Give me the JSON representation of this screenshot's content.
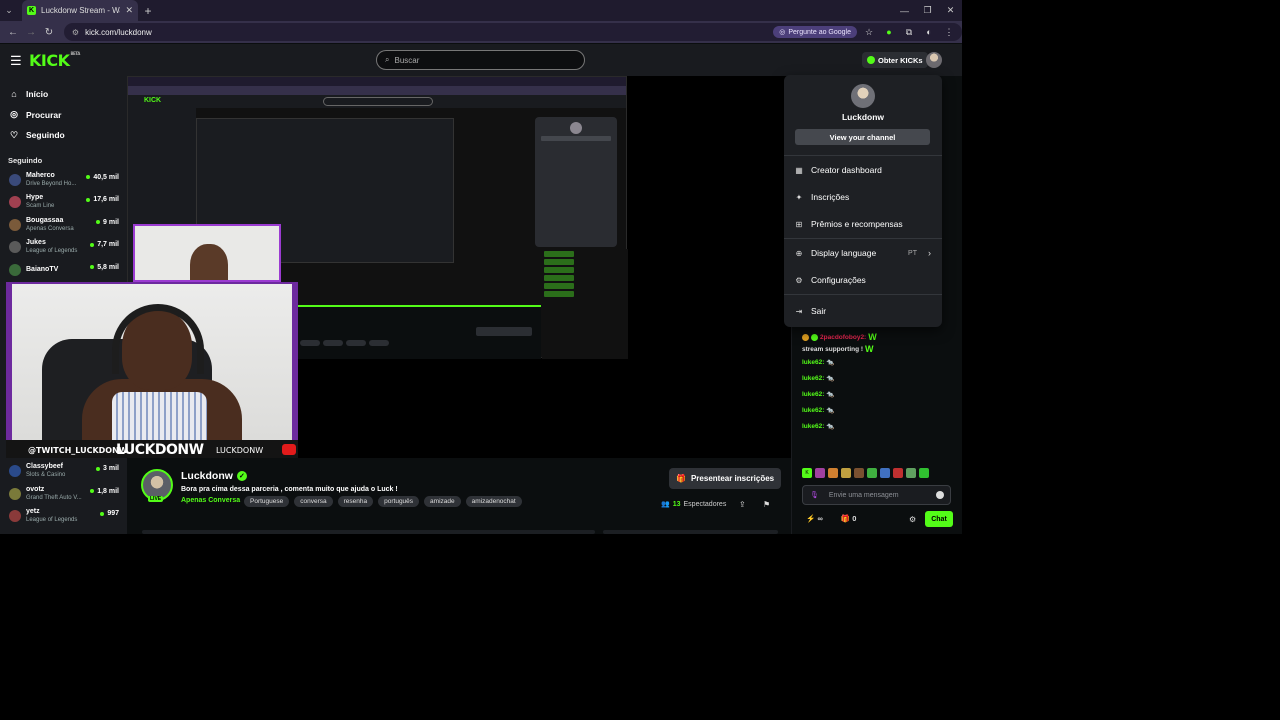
{
  "browser": {
    "tab_title": "Luckdonw Stream - Watch Live",
    "url": "kick.com/luckdonw",
    "ask_google": "Pergunte ao Google"
  },
  "header": {
    "logo": "KICK",
    "logo_badge": "BETA",
    "search_placeholder": "Buscar",
    "get_kicks": "Obter KICKs"
  },
  "sidebar": {
    "nav": [
      {
        "label": "Início",
        "icon": "home-icon"
      },
      {
        "label": "Procurar",
        "icon": "compass-icon"
      },
      {
        "label": "Seguindo",
        "icon": "heart-icon"
      }
    ],
    "following_title": "Seguindo",
    "channels": [
      {
        "name": "Maherco",
        "category": "Drive Beyond Ho...",
        "viewers": "40,5 mil",
        "color": "#3a4a7a"
      },
      {
        "name": "Hype",
        "category": "Scam Line",
        "viewers": "17,6 mil",
        "color": "#a04050"
      },
      {
        "name": "Bougassaa",
        "category": "Apenas Conversa",
        "viewers": "9 mil",
        "color": "#7a5a3a"
      },
      {
        "name": "Jukes",
        "category": "League of Legends",
        "viewers": "7,7 mil",
        "color": "#5a5a5a"
      },
      {
        "name": "BaianoTV",
        "category": "",
        "viewers": "5,8 mil",
        "color": "#3a6a3a"
      }
    ],
    "channels_bottom": [
      {
        "name": "Classybeef",
        "category": "Slots & Casino",
        "viewers": "3 mil",
        "color": "#2a4a8a"
      },
      {
        "name": "ovotz",
        "category": "Grand Theft Auto V...",
        "viewers": "1,8 mil",
        "color": "#7a7a3a"
      },
      {
        "name": "yetz",
        "category": "League of Legends",
        "viewers": "997",
        "color": "#8a3a3a"
      }
    ]
  },
  "overlay": {
    "handle": "@TWITCH_LUCKDONW",
    "big_name": "LUCKDONW",
    "small_name": "LUCKDONW"
  },
  "stream": {
    "name": "Luckdonw",
    "live_label": "LIVE",
    "title": "Bora pra cima dessa parceria , comenta muito que ajuda o Luck !",
    "category": "Apenas Conversa",
    "tags": [
      "Portuguese",
      "conversa",
      "resenha",
      "português",
      "amizade",
      "amizadenochat"
    ],
    "gift_button": "Presentear inscrições",
    "viewers_count": "13",
    "viewers_label": "Espectadores"
  },
  "chat": {
    "messages": [
      {
        "user": "2pacdofoboy2:",
        "text": "stream supporting !",
        "red": true
      },
      {
        "user": "luke62:",
        "text": "🐀",
        "red": false
      },
      {
        "user": "luke62:",
        "text": "🐀",
        "red": false
      },
      {
        "user": "luke62:",
        "text": "🐀",
        "red": false
      },
      {
        "user": "luke62:",
        "text": "🐀",
        "red": false
      },
      {
        "user": "luke62:",
        "text": "🐀",
        "red": false
      }
    ],
    "input_placeholder": "Envie uma mensagem",
    "points_value": "∞",
    "gifts_value": "0",
    "send_label": "Chat"
  },
  "dropdown": {
    "username": "Luckdonw",
    "view_channel": "View your channel",
    "items": [
      {
        "label": "Creator dashboard",
        "icon": "dashboard-icon"
      },
      {
        "label": "Inscrições",
        "icon": "subscriptions-icon"
      },
      {
        "label": "Prêmios e recompensas",
        "icon": "rewards-icon"
      },
      {
        "label": "Display language",
        "icon": "globe-icon",
        "value": "PT"
      },
      {
        "label": "Configurações",
        "icon": "gear-icon"
      },
      {
        "label": "Sair",
        "icon": "logout-icon"
      }
    ]
  },
  "colors": {
    "accent": "#53fc18",
    "background": "#0b0e0f",
    "panel": "#191b1f",
    "overlay_frame": "#6d2a9e"
  }
}
